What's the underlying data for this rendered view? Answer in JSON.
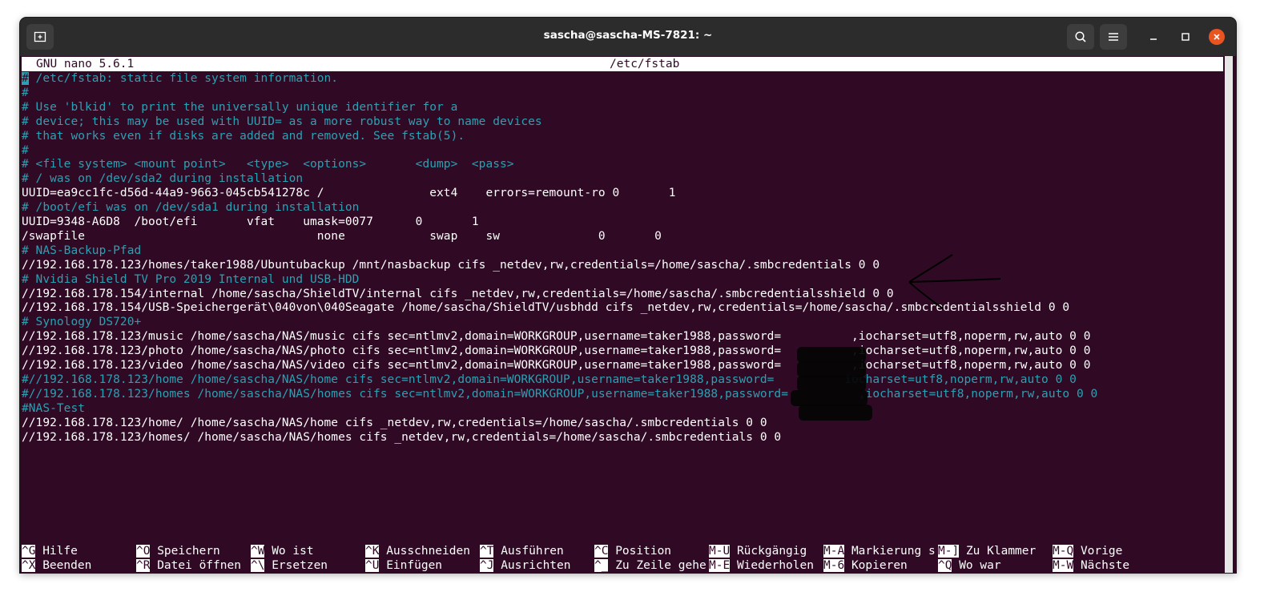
{
  "window": {
    "title": "sascha@sascha-MS-7821: ~",
    "colors": {
      "terminal_bg": "#300a24",
      "comment": "#2aa1b3",
      "text": "#ffffff",
      "close_button": "#e95420",
      "titlebar": "#2c2c2c"
    },
    "icons": [
      "new-tab-icon",
      "search-icon",
      "menu-icon",
      "minimize-icon",
      "maximize-icon",
      "close-icon"
    ]
  },
  "nano": {
    "version": "GNU nano 5.6.1",
    "filename": "/etc/fstab",
    "lines": [
      "# /etc/fstab: static file system information.",
      "#",
      "# Use 'blkid' to print the universally unique identifier for a",
      "# device; this may be used with UUID= as a more robust way to name devices",
      "# that works even if disks are added and removed. See fstab(5).",
      "#",
      "# <file system> <mount point>   <type>  <options>       <dump>  <pass>",
      "# / was on /dev/sda2 during installation",
      "UUID=ea9cc1fc-d56d-44a9-9663-045cb541278c /               ext4    errors=remount-ro 0       1",
      "# /boot/efi was on /dev/sda1 during installation",
      "UUID=9348-A6D8  /boot/efi       vfat    umask=0077      0       1",
      "/swapfile                                 none            swap    sw              0       0",
      "# NAS-Backup-Pfad",
      "//192.168.178.123/homes/taker1988/Ubuntubackup /mnt/nasbackup cifs _netdev,rw,credentials=/home/sascha/.smbcredentials 0 0",
      "# Nvidia Shield TV Pro 2019 Internal und USB-HDD",
      "//192.168.178.154/internal /home/sascha/ShieldTV/internal cifs _netdev,rw,credentials=/home/sascha/.smbcredentialsshield 0 0",
      "//192.168.178.154/USB-Speichergerät\\040von\\040Seagate /home/sascha/ShieldTV/usbhdd cifs _netdev,rw,credentials=/home/sascha/.smbcredentialsshield 0 0",
      "# Synology DS720+",
      "//192.168.178.123/music /home/sascha/NAS/music cifs sec=ntlmv2,domain=WORKGROUP,username=taker1988,password=          ,iocharset=utf8,noperm,rw,auto 0 0",
      "//192.168.178.123/photo /home/sascha/NAS/photo cifs sec=ntlmv2,domain=WORKGROUP,username=taker1988,password=          ,iocharset=utf8,noperm,rw,auto 0 0",
      "//192.168.178.123/video /home/sascha/NAS/video cifs sec=ntlmv2,domain=WORKGROUP,username=taker1988,password=          ,iocharset=utf8,noperm,rw,auto 0 0",
      "#//192.168.178.123/home /home/sascha/NAS/home cifs sec=ntlmv2,domain=WORKGROUP,username=taker1988,password=          iocharset=utf8,noperm,rw,auto 0 0",
      "#//192.168.178.123/homes /home/sascha/NAS/homes cifs sec=ntlmv2,domain=WORKGROUP,username=taker1988,password=          ,iocharset=utf8,noperm,rw,auto 0 0",
      "#NAS-Test",
      "//192.168.178.123/home/ /home/sascha/NAS/home cifs _netdev,rw,credentials=/home/sascha/.smbcredentials 0 0",
      "//192.168.178.123/homes/ /home/sascha/NAS/homes cifs _netdev,rw,credentials=/home/sascha/.smbcredentials 0 0"
    ],
    "comment_flags": [
      true,
      true,
      true,
      true,
      true,
      true,
      true,
      true,
      false,
      true,
      false,
      false,
      true,
      false,
      true,
      false,
      false,
      true,
      false,
      false,
      false,
      true,
      true,
      true,
      false,
      false
    ],
    "shortcuts_row1": [
      {
        "key": "^G",
        "label": "Hilfe"
      },
      {
        "key": "^O",
        "label": "Speichern"
      },
      {
        "key": "^W",
        "label": "Wo ist"
      },
      {
        "key": "^K",
        "label": "Ausschneiden"
      },
      {
        "key": "^T",
        "label": "Ausführen"
      },
      {
        "key": "^C",
        "label": "Position"
      },
      {
        "key": "M-U",
        "label": "Rückgängig"
      },
      {
        "key": "M-A",
        "label": "Markierung s"
      },
      {
        "key": "M-]",
        "label": "Zu Klammer"
      },
      {
        "key": "M-Q",
        "label": "Vorige"
      }
    ],
    "shortcuts_row2": [
      {
        "key": "^X",
        "label": "Beenden"
      },
      {
        "key": "^R",
        "label": "Datei öffnen"
      },
      {
        "key": "^\\",
        "label": "Ersetzen"
      },
      {
        "key": "^U",
        "label": "Einfügen"
      },
      {
        "key": "^J",
        "label": "Ausrichten"
      },
      {
        "key": "^_",
        "label": "Zu Zeile gehe"
      },
      {
        "key": "M-E",
        "label": "Wiederholen"
      },
      {
        "key": "M-6",
        "label": "Kopieren"
      },
      {
        "key": "^Q",
        "label": "Wo war"
      },
      {
        "key": "M-W",
        "label": "Nächste"
      }
    ]
  }
}
